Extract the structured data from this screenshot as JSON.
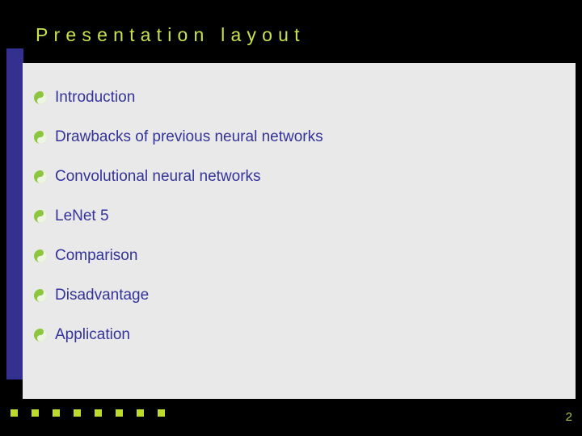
{
  "slide": {
    "title": "Presentation layout",
    "page_number": "2",
    "colors": {
      "background": "#000000",
      "title_text": "#cbe24f",
      "accent_bar": "#33308f",
      "panel_background": "#e9e9e9",
      "bullet_text": "#333399",
      "bullet_marker": "#8cc63f",
      "deco_square": "#bddb2c",
      "page_number_text": "#a8c93a"
    },
    "bullets": [
      {
        "marker_icon": "yin-yang-bullet-icon",
        "label": "Introduction"
      },
      {
        "marker_icon": "yin-yang-bullet-icon",
        "label": "Drawbacks of previous neural networks"
      },
      {
        "marker_icon": "yin-yang-bullet-icon",
        "label": "Convolutional neural networks"
      },
      {
        "marker_icon": "yin-yang-bullet-icon",
        "label": "LeNet 5"
      },
      {
        "marker_icon": "yin-yang-bullet-icon",
        "label": "Comparison"
      },
      {
        "marker_icon": "yin-yang-bullet-icon",
        "label": "Disadvantage"
      },
      {
        "marker_icon": "yin-yang-bullet-icon",
        "label": "Application"
      }
    ],
    "decoration": {
      "square_count": 8,
      "square_spacing_px": 26
    }
  }
}
